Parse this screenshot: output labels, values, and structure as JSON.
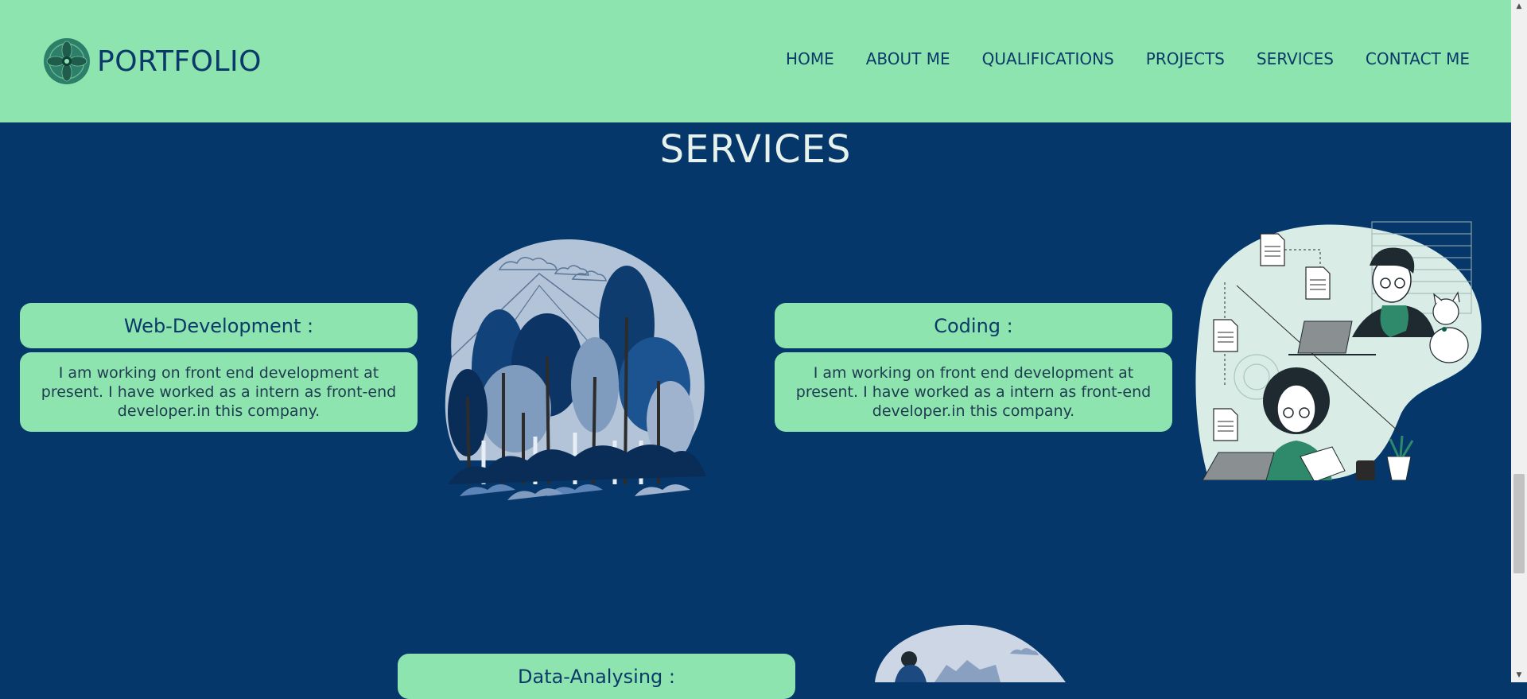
{
  "header": {
    "logo_text": "PORTFOLIO",
    "logo_icon": "mandala-icon",
    "nav": [
      "HOME",
      "ABOUT ME",
      "QUALIFICATIONS",
      "PROJECTS",
      "SERVICES",
      "CONTACT ME"
    ]
  },
  "services": {
    "title": "SERVICES",
    "cards": [
      {
        "title": "Web-Development :",
        "text": "I am working on front end development at present. I have worked as a intern as front-end developer.in this company."
      },
      {
        "title": "Coding :",
        "text": "I am working on front end development at present. I have worked as a intern as front-end developer.in this company."
      },
      {
        "title": "Data-Analysing :"
      }
    ]
  },
  "colors": {
    "header_bg": "#8ee4ae",
    "section_bg": "#05376b",
    "text_dark": "#0b3a6a"
  }
}
